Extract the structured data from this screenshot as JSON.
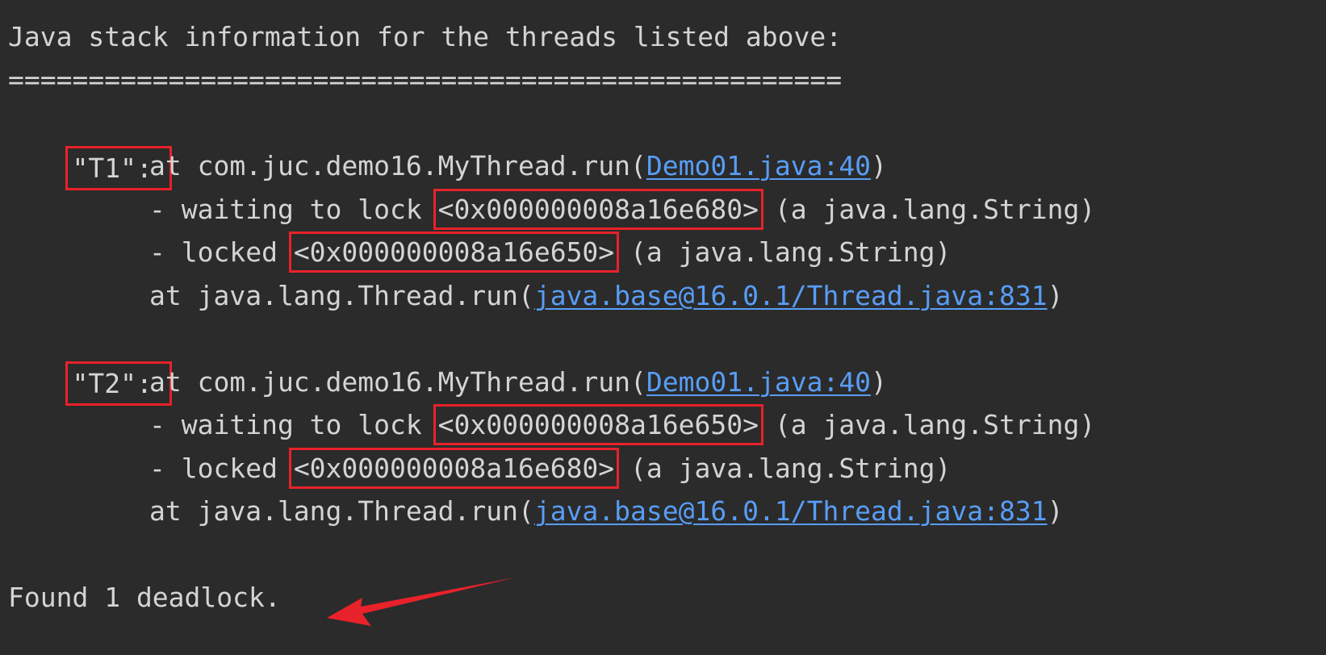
{
  "console": {
    "header": "Java stack information for the threads listed above:",
    "separator": "====================================================",
    "threads": [
      {
        "name": "\"T1\":",
        "frame1_prefix": "at com.juc.demo16.MyThread.run(",
        "frame1_link": "Demo01.java:40",
        "frame1_suffix": ")",
        "waiting_prefix": "- waiting to lock ",
        "waiting_addr": "<0x000000008a16e680>",
        "waiting_suffix": " (a java.lang.String)",
        "locked_prefix": "- locked ",
        "locked_addr": "<0x000000008a16e650>",
        "locked_suffix": " (a java.lang.String)",
        "frame2_prefix": "at java.lang.Thread.run(",
        "frame2_link": "java.base@16.0.1/Thread.java:831",
        "frame2_suffix": ")"
      },
      {
        "name": "\"T2\":",
        "frame1_prefix": "at com.juc.demo16.MyThread.run(",
        "frame1_link": "Demo01.java:40",
        "frame1_suffix": ")",
        "waiting_prefix": "- waiting to lock ",
        "waiting_addr": "<0x000000008a16e650>",
        "waiting_suffix": " (a java.lang.String)",
        "locked_prefix": "- locked ",
        "locked_addr": "<0x000000008a16e680>",
        "locked_suffix": " (a java.lang.String)",
        "frame2_prefix": "at java.lang.Thread.run(",
        "frame2_link": "java.base@16.0.1/Thread.java:831",
        "frame2_suffix": ")"
      }
    ],
    "footer": "Found 1 deadlock."
  },
  "colors": {
    "background": "#2b2b2b",
    "text": "#d4d4d4",
    "link": "#589df6",
    "annotation": "#e8222a"
  }
}
